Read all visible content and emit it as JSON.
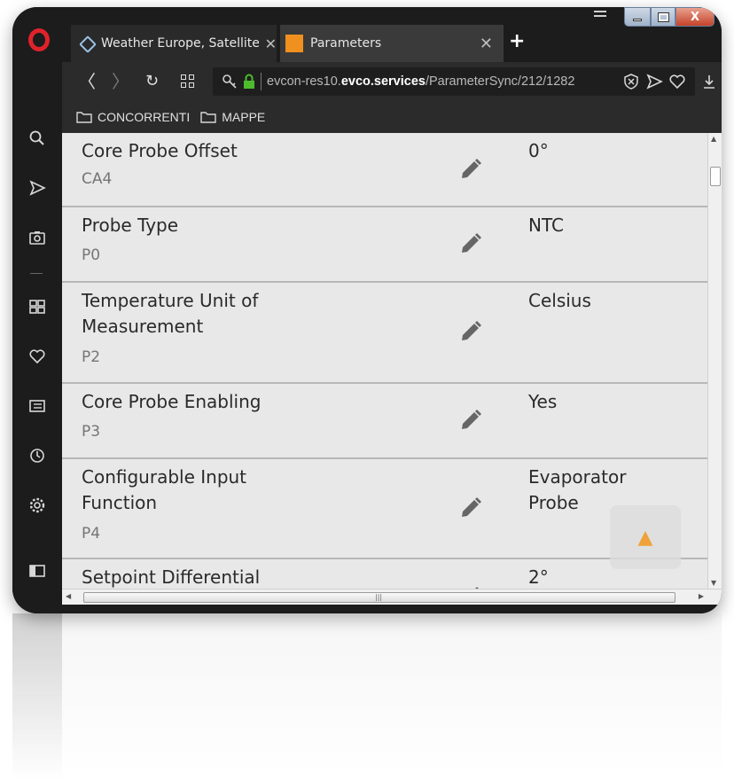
{
  "tabs": [
    {
      "title": "Weather Europe, Satellite \\",
      "favicon": "satellite-icon",
      "active": false
    },
    {
      "title": "Parameters",
      "favicon": "orange-square-icon",
      "active": true
    }
  ],
  "address_bar": {
    "url_prefix": "evcon-res10.",
    "url_domain": "evco.services",
    "url_path": "/ParameterSync/212/1282"
  },
  "bookmarks": [
    {
      "label": "CONCORRENTI"
    },
    {
      "label": "MAPPE"
    }
  ],
  "parameters": [
    {
      "name": "Core Probe Offset",
      "code": "CA4",
      "value": "0°"
    },
    {
      "name": "Probe Type",
      "code": "P0",
      "value": "NTC"
    },
    {
      "name": "Temperature Unit of Measurement",
      "code": "P2",
      "value": "Celsius"
    },
    {
      "name": "Core Probe Enabling",
      "code": "P3",
      "value": "Yes"
    },
    {
      "name": "Configurable Input Function",
      "code": "P4",
      "value": "Evaporator Probe"
    },
    {
      "name": "Setpoint Differential",
      "code": "",
      "value": "2°"
    }
  ],
  "colors": {
    "opera_red": "#e0222b",
    "tab_favicon_orange": "#f0901e",
    "scroll_arrow": "#f0a23a",
    "content_bg": "#e8e8e8"
  },
  "icons": {
    "edit": "pencil-icon",
    "scroll_top": "triangle-up-icon",
    "sidebar": [
      "search-icon",
      "send-icon",
      "camera-icon",
      "speed-dial-icon",
      "heart-icon",
      "news-icon",
      "history-icon",
      "settings-icon",
      "sidebar-toggle-icon"
    ]
  }
}
